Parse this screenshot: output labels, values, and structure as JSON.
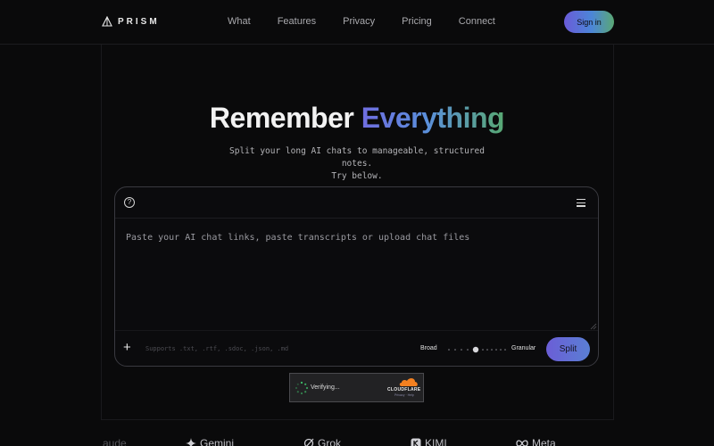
{
  "nav": {
    "logo_text": "PRISM",
    "links": [
      "What",
      "Features",
      "Privacy",
      "Pricing",
      "Connect"
    ],
    "signin_label": "Sign in",
    "signin_colors": [
      "#6a5bd8",
      "#4c86d8",
      "#5aa874"
    ]
  },
  "hero": {
    "title_part1": "Remember",
    "title_part2": "Everything",
    "subtitle_line1": "Split your long AI chats to manageable, structured notes.",
    "subtitle_line2": "Try below.",
    "gradient": [
      "#6f6de0",
      "#5b8fdc",
      "#58a873"
    ]
  },
  "editor": {
    "help_icon": "question-circle-icon",
    "menu_icon": "hamburger-menu-icon",
    "placeholder": "Paste your AI chat links, paste transcripts or upload chat files",
    "value": "",
    "supports_text": "Supports .txt, .rtf, .sdoc, .json, .md",
    "granularity": {
      "left_label": "Broad",
      "right_label": "Granular",
      "value": 0.5
    },
    "split_label": "Split"
  },
  "captcha": {
    "status_text": "Verifying...",
    "provider": "CLOUDFLARE",
    "links": "Privacy · Help"
  },
  "brands": [
    "aude",
    "Gemini",
    "Grok",
    "KIMI",
    "Meta"
  ]
}
